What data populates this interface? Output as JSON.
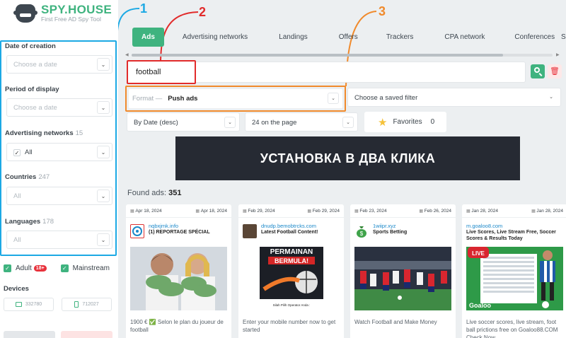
{
  "brand": {
    "title": "SPY.HOUSE",
    "subtitle": "First Free AD Spy Tool"
  },
  "sidebar": {
    "date_of_creation": {
      "label": "Date of creation",
      "placeholder": "Choose a date"
    },
    "period_of_display": {
      "label": "Period of display",
      "placeholder": "Choose a date"
    },
    "advertising_networks": {
      "label": "Advertising networks",
      "count": "15",
      "value": "All"
    },
    "countries": {
      "label": "Countries",
      "count": "247",
      "value": "All"
    },
    "languages": {
      "label": "Languages",
      "count": "178",
      "value": "All"
    },
    "adult": {
      "label": "Adult",
      "badge": "18+"
    },
    "mainstream": {
      "label": "Mainstream"
    },
    "devices": {
      "label": "Devices",
      "desktop": "332780",
      "mobile": "712027"
    }
  },
  "tabs": [
    "Ads",
    "Advertising networks",
    "Landings",
    "Offers",
    "Trackers",
    "CPA network",
    "Conferences",
    "S"
  ],
  "search": {
    "value": "football"
  },
  "format": {
    "label": "Format —",
    "value": "Push ads"
  },
  "saved_filter": {
    "placeholder": "Choose a saved filter"
  },
  "sort": {
    "value": "By Date (desc)"
  },
  "per_page": {
    "value": "24 on the page"
  },
  "favorites": {
    "label": "Favorites",
    "count": "0"
  },
  "banner": {
    "text": "УСТАНОВКА В ДВА КЛИКА"
  },
  "found": {
    "label": "Found ads:",
    "count": "351"
  },
  "cards": [
    {
      "date_start": "Apr 18, 2024",
      "date_end": "Apr 18, 2024",
      "domain": "nqbxjmk.info",
      "title": "(1) REPORTAGE SPÉCIAL",
      "text": "1900 € ✅ Selon le plan du joueur de football"
    },
    {
      "date_start": "Feb 29, 2024",
      "date_end": "Feb 29, 2024",
      "domain": "dnudp.bemobtrcks.com",
      "title": "Latest Football Content!",
      "text": "Enter your mobile number now to get started",
      "img_text1": "PERMAINAN",
      "img_text2": "BERMULA!",
      "img_caption": "Silah Pilih Operator Anda :"
    },
    {
      "date_start": "Feb 23, 2024",
      "date_end": "Feb 26, 2024",
      "domain": "1wiipr.xyz",
      "title": "Sports Betting",
      "text": "Watch Football and Make Money"
    },
    {
      "date_start": "Jan 28, 2024",
      "date_end": "Jan 28, 2024",
      "domain": "m.goaloo8.com",
      "title": "Live Scores, Live Stream Free, Soccer Scores & Results Today",
      "text": "Live soccer scores, live stream, foot ball prictions free on Goaloo88.COM Check Now.",
      "img_live": "LIVE",
      "img_logo": "Goaloo"
    }
  ],
  "annotations": [
    "1",
    "2",
    "3"
  ],
  "colors": {
    "accent": "#3fb37f",
    "annotation1": "#1ca9e4",
    "annotation2": "#e12b2b",
    "annotation3": "#f08a2c"
  }
}
